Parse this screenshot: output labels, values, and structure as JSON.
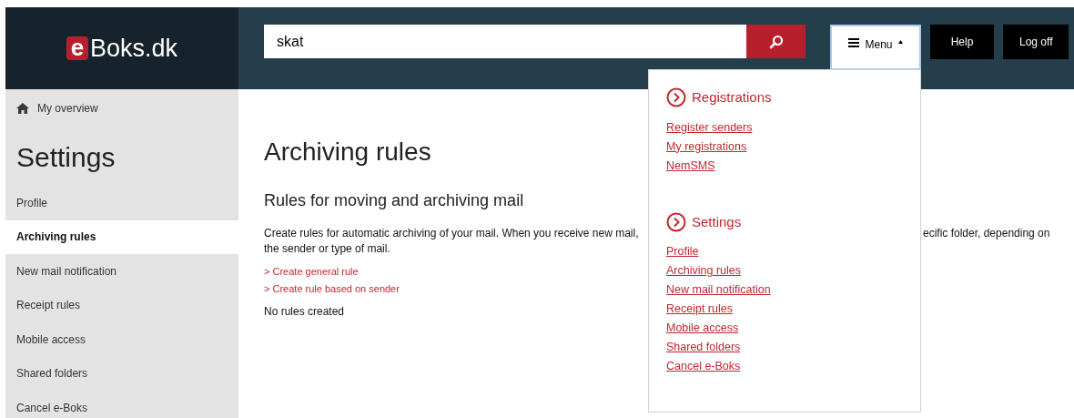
{
  "logo": {
    "mark": "e",
    "text": "Boks.dk"
  },
  "search": {
    "value": "skat"
  },
  "header_buttons": [
    {
      "label": "Menu",
      "kind": "menu",
      "expanded": true
    },
    {
      "label": "Help",
      "kind": "plain"
    },
    {
      "label": "Log off",
      "kind": "plain"
    }
  ],
  "sidebar": {
    "home": "My overview",
    "title": "Settings",
    "items": [
      {
        "label": "Profile",
        "selected": false
      },
      {
        "label": "Archiving rules",
        "selected": true
      },
      {
        "label": "New mail notification",
        "selected": false
      },
      {
        "label": "Receipt rules",
        "selected": false
      },
      {
        "label": "Mobile access",
        "selected": false
      },
      {
        "label": "Shared folders",
        "selected": false
      },
      {
        "label": "Cancel e-Boks",
        "selected": false
      }
    ]
  },
  "main": {
    "title": "Archiving rules",
    "subtitle": "Rules for moving and archiving mail",
    "description_lines": [
      [
        "Create rules for automatic archiving of your mail. When you receive new mail,",
        "ecific folder, depending on"
      ],
      [
        "the sender or type of mail."
      ]
    ],
    "links": [
      "> Create general rule",
      "> Create rule based on sender"
    ],
    "empty_text": "No rules created"
  },
  "menu_dropdown": [
    {
      "heading": "Registrations",
      "links": [
        "Register senders",
        "My registrations",
        "NemSMS"
      ]
    },
    {
      "heading": "Settings",
      "links": [
        "Profile",
        "Archiving rules",
        "New mail notification",
        "Receipt rules",
        "Mobile access",
        "Shared folders",
        "Cancel e-Boks"
      ]
    }
  ]
}
